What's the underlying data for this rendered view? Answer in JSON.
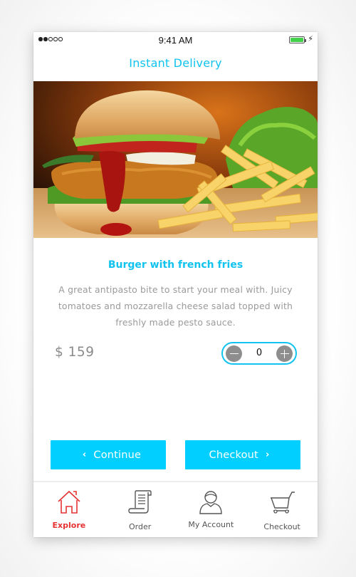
{
  "status_bar": {
    "signal_dots_filled": 2,
    "signal_dots_total": 5,
    "time": "9:41 AM",
    "battery_level": 1.0,
    "charging": true
  },
  "header": {
    "title": "Instant Delivery"
  },
  "product": {
    "image_description": "Burger with french fries photo",
    "name": "Burger with french fries",
    "description": "A great antipasto bite to start your meal with. Juicy tomatoes and mozzarella cheese salad topped with freshly made pesto sauce.",
    "price": "$ 159",
    "quantity": "0"
  },
  "actions": {
    "continue_label": "Continue",
    "checkout_label": "Checkout"
  },
  "tabbar": {
    "items": [
      {
        "label": "Explore",
        "icon": "home-icon",
        "active": true
      },
      {
        "label": "Order",
        "icon": "receipt-scroll-icon",
        "active": false
      },
      {
        "label": "My Account",
        "icon": "user-icon",
        "active": false
      },
      {
        "label": "Checkout",
        "icon": "cart-icon",
        "active": false
      }
    ]
  },
  "colors": {
    "accent": "#12c3ef",
    "button": "#00cfff",
    "active_tab": "#e53232",
    "battery": "#43d14c"
  }
}
